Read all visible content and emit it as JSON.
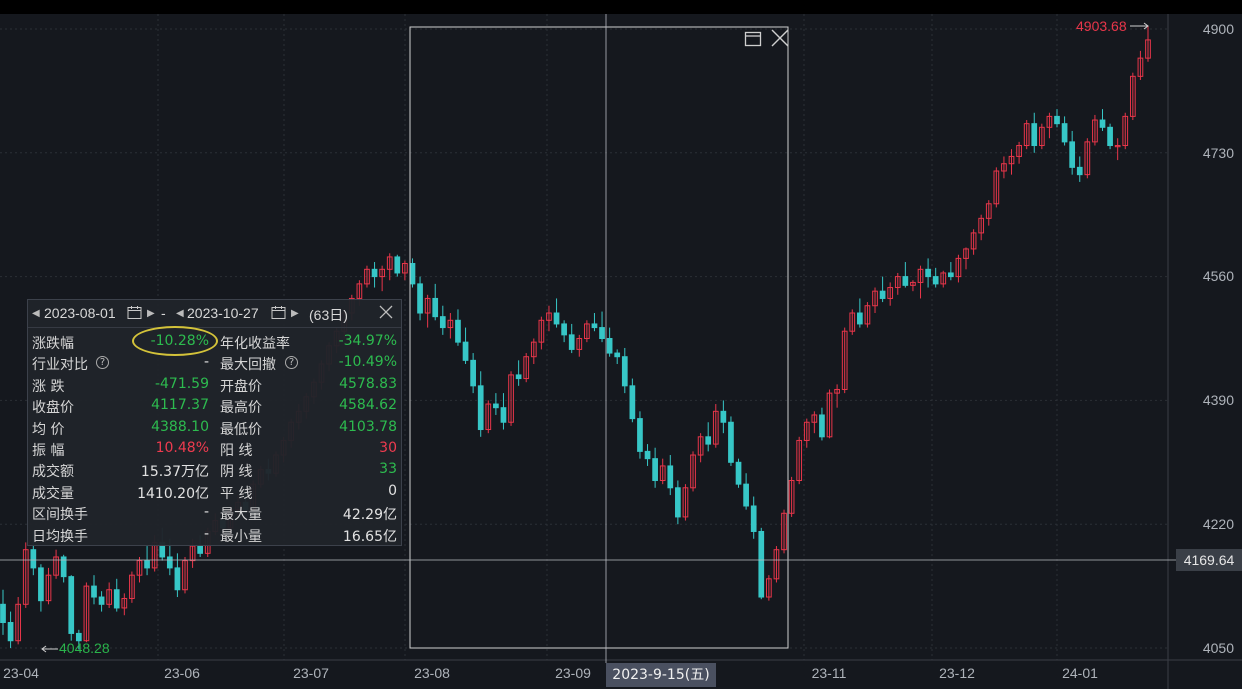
{
  "y_axis": {
    "ticks": [
      "4900",
      "4730",
      "4560",
      "4390",
      "4220",
      "4050"
    ]
  },
  "x_axis": {
    "ticks": [
      "23-04",
      "23-06",
      "23-07",
      "23-08",
      "23-09",
      "23-11",
      "23-12",
      "24-01"
    ]
  },
  "crosshair": {
    "price": "4169.64",
    "date": "2023-9-15(五)"
  },
  "markers": {
    "high": "4903.68",
    "low": "4048.28"
  },
  "colors": {
    "up": "#e8364a",
    "down": "#37c7c7",
    "bg": "#15181e",
    "green": "#2dbb4f",
    "red": "#ee3b4f",
    "highlight": "#d4c33a"
  },
  "selection": {
    "icons": [
      "window-restore-icon",
      "close-icon"
    ],
    "start_date": "2023-08-01",
    "end_date": "2023-10-27",
    "separator": "-",
    "days": "(63日)"
  },
  "stats": {
    "left": [
      {
        "label": "涨跌幅",
        "value": "-10.28%",
        "color": "green"
      },
      {
        "label": "行业对比",
        "value": "-",
        "color": "white",
        "help": "?"
      },
      {
        "label": "涨  跌",
        "value": "-471.59",
        "color": "green"
      },
      {
        "label": "收盘价",
        "value": "4117.37",
        "color": "green"
      },
      {
        "label": "均  价",
        "value": "4388.10",
        "color": "green"
      },
      {
        "label": "振  幅",
        "value": "10.48%",
        "color": "red"
      },
      {
        "label": "成交额",
        "value": "15.37万亿",
        "color": "white"
      },
      {
        "label": "成交量",
        "value": "1410.20亿",
        "color": "white"
      },
      {
        "label": "区间换手",
        "value": "-",
        "color": "white"
      },
      {
        "label": "日均换手",
        "value": "-",
        "color": "white"
      }
    ],
    "right": [
      {
        "label": "年化收益率",
        "value": "-34.97%",
        "color": "green"
      },
      {
        "label": "最大回撤",
        "value": "-10.49%",
        "color": "green",
        "help": "?"
      },
      {
        "label": "开盘价",
        "value": "4578.83",
        "color": "green"
      },
      {
        "label": "最高价",
        "value": "4584.62",
        "color": "green"
      },
      {
        "label": "最低价",
        "value": "4103.78",
        "color": "green"
      },
      {
        "label": "阳  线",
        "value": "30",
        "color": "red"
      },
      {
        "label": "阴  线",
        "value": "33",
        "color": "green"
      },
      {
        "label": "平  线",
        "value": "0",
        "color": "white"
      },
      {
        "label": "最大量",
        "value": "42.29亿",
        "color": "white"
      },
      {
        "label": "最小量",
        "value": "16.65亿",
        "color": "white"
      }
    ]
  },
  "chart_data": {
    "type": "candlestick",
    "ylim": [
      4050,
      4900
    ],
    "candles": [
      [
        4110,
        4130,
        4068,
        4085
      ],
      [
        4085,
        4100,
        4050,
        4060
      ],
      [
        4060,
        4120,
        4055,
        4110
      ],
      [
        4110,
        4195,
        4105,
        4185
      ],
      [
        4185,
        4210,
        4150,
        4160
      ],
      [
        4160,
        4165,
        4100,
        4115
      ],
      [
        4115,
        4160,
        4110,
        4150
      ],
      [
        4150,
        4185,
        4145,
        4175
      ],
      [
        4175,
        4178,
        4140,
        4148
      ],
      [
        4148,
        4150,
        4060,
        4070
      ],
      [
        4070,
        4075,
        4048,
        4060
      ],
      [
        4060,
        4140,
        4058,
        4135
      ],
      [
        4135,
        4150,
        4110,
        4120
      ],
      [
        4120,
        4128,
        4100,
        4110
      ],
      [
        4110,
        4140,
        4105,
        4130
      ],
      [
        4130,
        4145,
        4100,
        4105
      ],
      [
        4105,
        4125,
        4095,
        4118
      ],
      [
        4118,
        4155,
        4112,
        4150
      ],
      [
        4150,
        4175,
        4140,
        4170
      ],
      [
        4170,
        4190,
        4150,
        4160
      ],
      [
        4160,
        4205,
        4155,
        4195
      ],
      [
        4195,
        4215,
        4170,
        4175
      ],
      [
        4175,
        4200,
        4150,
        4160
      ],
      [
        4160,
        4180,
        4120,
        4130
      ],
      [
        4130,
        4175,
        4125,
        4170
      ],
      [
        4170,
        4200,
        4160,
        4190
      ],
      [
        4190,
        4205,
        4175,
        4180
      ],
      [
        4180,
        4215,
        4175,
        4210
      ],
      [
        4210,
        4235,
        4205,
        4225
      ],
      [
        4225,
        4240,
        4210,
        4215
      ],
      [
        4215,
        4245,
        4205,
        4240
      ],
      [
        4240,
        4260,
        4230,
        4250
      ],
      [
        4250,
        4265,
        4235,
        4240
      ],
      [
        4240,
        4280,
        4238,
        4275
      ],
      [
        4275,
        4300,
        4270,
        4295
      ],
      [
        4295,
        4310,
        4280,
        4290
      ],
      [
        4290,
        4320,
        4285,
        4315
      ],
      [
        4315,
        4340,
        4305,
        4335
      ],
      [
        4335,
        4365,
        4325,
        4360
      ],
      [
        4360,
        4385,
        4350,
        4375
      ],
      [
        4375,
        4400,
        4365,
        4395
      ],
      [
        4395,
        4420,
        4385,
        4415
      ],
      [
        4415,
        4445,
        4405,
        4440
      ],
      [
        4440,
        4470,
        4430,
        4465
      ],
      [
        4465,
        4490,
        4455,
        4485
      ],
      [
        4485,
        4515,
        4475,
        4510
      ],
      [
        4510,
        4535,
        4500,
        4530
      ],
      [
        4530,
        4555,
        4520,
        4550
      ],
      [
        4550,
        4575,
        4545,
        4570
      ],
      [
        4570,
        4580,
        4545,
        4560
      ],
      [
        4560,
        4575,
        4540,
        4570
      ],
      [
        4570,
        4592,
        4555,
        4587
      ],
      [
        4587,
        4590,
        4560,
        4565
      ],
      [
        4565,
        4582,
        4555,
        4578
      ],
      [
        4578,
        4585,
        4545,
        4550
      ],
      [
        4550,
        4560,
        4500,
        4510
      ],
      [
        4510,
        4535,
        4490,
        4530
      ],
      [
        4530,
        4550,
        4500,
        4505
      ],
      [
        4505,
        4520,
        4480,
        4490
      ],
      [
        4490,
        4510,
        4475,
        4500
      ],
      [
        4500,
        4515,
        4465,
        4470
      ],
      [
        4470,
        4490,
        4440,
        4445
      ],
      [
        4445,
        4455,
        4400,
        4410
      ],
      [
        4410,
        4430,
        4340,
        4350
      ],
      [
        4350,
        4390,
        4345,
        4385
      ],
      [
        4385,
        4400,
        4370,
        4380
      ],
      [
        4380,
        4400,
        4350,
        4360
      ],
      [
        4360,
        4430,
        4355,
        4425
      ],
      [
        4425,
        4445,
        4410,
        4420
      ],
      [
        4420,
        4455,
        4415,
        4450
      ],
      [
        4450,
        4475,
        4440,
        4470
      ],
      [
        4470,
        4505,
        4460,
        4500
      ],
      [
        4500,
        4520,
        4485,
        4510
      ],
      [
        4510,
        4530,
        4490,
        4495
      ],
      [
        4495,
        4500,
        4470,
        4480
      ],
      [
        4480,
        4495,
        4455,
        4460
      ],
      [
        4460,
        4480,
        4450,
        4475
      ],
      [
        4475,
        4500,
        4470,
        4495
      ],
      [
        4495,
        4510,
        4485,
        4490
      ],
      [
        4490,
        4512,
        4470,
        4475
      ],
      [
        4475,
        4490,
        4450,
        4455
      ],
      [
        4455,
        4460,
        4440,
        4450
      ],
      [
        4450,
        4462,
        4400,
        4410
      ],
      [
        4410,
        4420,
        4360,
        4365
      ],
      [
        4365,
        4375,
        4310,
        4320
      ],
      [
        4320,
        4330,
        4300,
        4310
      ],
      [
        4310,
        4325,
        4270,
        4280
      ],
      [
        4280,
        4310,
        4275,
        4300
      ],
      [
        4300,
        4315,
        4260,
        4270
      ],
      [
        4270,
        4280,
        4220,
        4230
      ],
      [
        4230,
        4275,
        4225,
        4270
      ],
      [
        4270,
        4320,
        4265,
        4315
      ],
      [
        4315,
        4345,
        4305,
        4340
      ],
      [
        4340,
        4360,
        4320,
        4330
      ],
      [
        4330,
        4385,
        4325,
        4375
      ],
      [
        4375,
        4390,
        4345,
        4360
      ],
      [
        4360,
        4368,
        4300,
        4305
      ],
      [
        4305,
        4310,
        4270,
        4275
      ],
      [
        4275,
        4290,
        4240,
        4245
      ],
      [
        4245,
        4258,
        4200,
        4210
      ],
      [
        4210,
        4215,
        4117,
        4120
      ],
      [
        4120,
        4150,
        4115,
        4145
      ],
      [
        4145,
        4190,
        4140,
        4185
      ],
      [
        4185,
        4240,
        4180,
        4235
      ],
      [
        4235,
        4285,
        4230,
        4280
      ],
      [
        4280,
        4340,
        4275,
        4335
      ],
      [
        4335,
        4365,
        4325,
        4360
      ],
      [
        4360,
        4375,
        4345,
        4370
      ],
      [
        4370,
        4380,
        4335,
        4340
      ],
      [
        4340,
        4405,
        4338,
        4400
      ],
      [
        4400,
        4412,
        4380,
        4405
      ],
      [
        4405,
        4490,
        4400,
        4485
      ],
      [
        4485,
        4515,
        4480,
        4510
      ],
      [
        4510,
        4530,
        4490,
        4495
      ],
      [
        4495,
        4525,
        4490,
        4520
      ],
      [
        4520,
        4545,
        4510,
        4540
      ],
      [
        4540,
        4560,
        4525,
        4530
      ],
      [
        4530,
        4552,
        4520,
        4545
      ],
      [
        4545,
        4565,
        4535,
        4560
      ],
      [
        4560,
        4580,
        4545,
        4548
      ],
      [
        4548,
        4555,
        4540,
        4552
      ],
      [
        4552,
        4575,
        4530,
        4570
      ],
      [
        4570,
        4585,
        4545,
        4560
      ],
      [
        4560,
        4572,
        4545,
        4550
      ],
      [
        4550,
        4568,
        4545,
        4565
      ],
      [
        4565,
        4580,
        4555,
        4560
      ],
      [
        4560,
        4590,
        4552,
        4585
      ],
      [
        4585,
        4600,
        4570,
        4598
      ],
      [
        4598,
        4625,
        4590,
        4620
      ],
      [
        4620,
        4645,
        4610,
        4640
      ],
      [
        4640,
        4665,
        4630,
        4660
      ],
      [
        4660,
        4710,
        4655,
        4705
      ],
      [
        4705,
        4725,
        4695,
        4715
      ],
      [
        4715,
        4735,
        4700,
        4725
      ],
      [
        4725,
        4745,
        4715,
        4740
      ],
      [
        4740,
        4775,
        4735,
        4770
      ],
      [
        4770,
        4785,
        4730,
        4740
      ],
      [
        4740,
        4770,
        4735,
        4765
      ],
      [
        4765,
        4785,
        4750,
        4780
      ],
      [
        4780,
        4790,
        4765,
        4770
      ],
      [
        4770,
        4780,
        4740,
        4745
      ],
      [
        4745,
        4760,
        4700,
        4710
      ],
      [
        4710,
        4725,
        4690,
        4700
      ],
      [
        4700,
        4750,
        4695,
        4745
      ],
      [
        4745,
        4782,
        4740,
        4775
      ],
      [
        4775,
        4790,
        4760,
        4765
      ],
      [
        4765,
        4770,
        4735,
        4740
      ],
      [
        4740,
        4750,
        4720,
        4740
      ],
      [
        4740,
        4785,
        4735,
        4780
      ],
      [
        4780,
        4840,
        4775,
        4835
      ],
      [
        4835,
        4870,
        4830,
        4860
      ],
      [
        4860,
        4904,
        4855,
        4885
      ]
    ]
  }
}
